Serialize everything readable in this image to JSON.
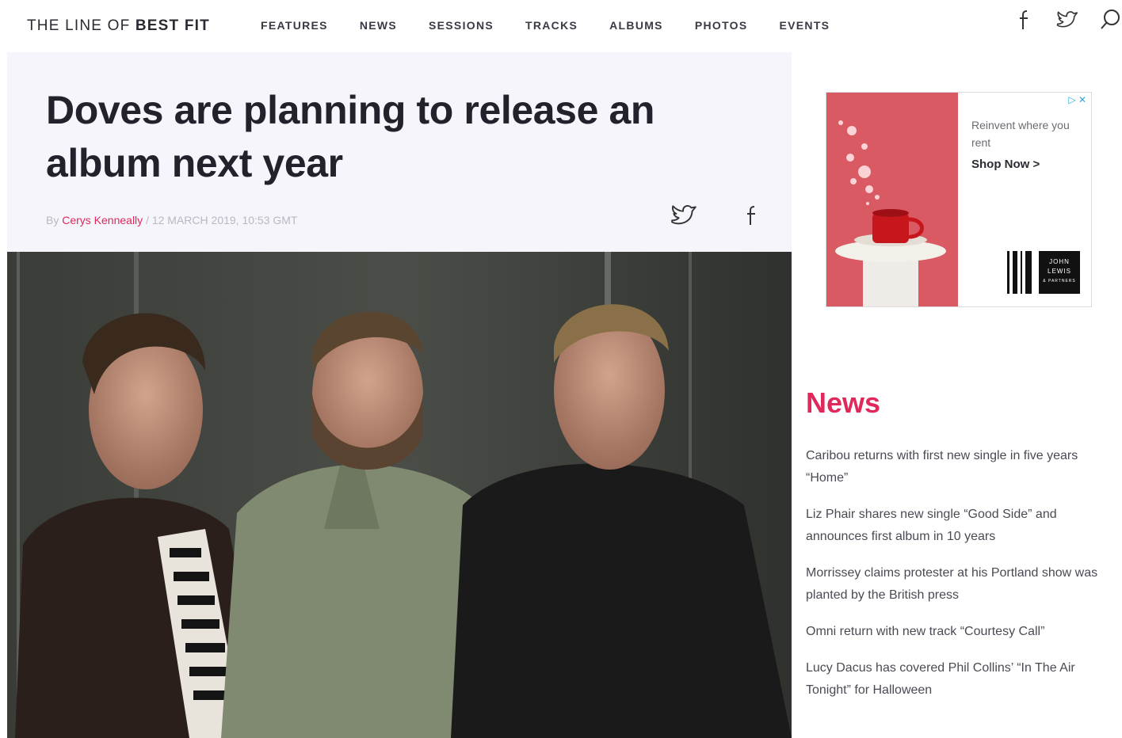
{
  "site": {
    "logo_light": "THE LINE OF",
    "logo_bold": "BEST FIT"
  },
  "nav": {
    "items": [
      "FEATURES",
      "NEWS",
      "SESSIONS",
      "TRACKS",
      "ALBUMS",
      "PHOTOS",
      "EVENTS"
    ],
    "icons": [
      "facebook-icon",
      "twitter-icon",
      "search-icon"
    ]
  },
  "article": {
    "headline": "Doves are planning to release an album next year",
    "byline_prefix": "By",
    "author": "Cerys Kenneally",
    "date_sep": "/",
    "date": "12 MARCH 2019, 10:53 GMT",
    "share_icons": [
      "twitter-icon",
      "facebook-icon"
    ]
  },
  "ad": {
    "text": "Reinvent where you rent",
    "cta": "Shop Now >",
    "badge": "▷ ✕",
    "brand_lines": [
      "JOHN",
      "LEWIS",
      "& PARTNERS"
    ],
    "colors": {
      "panel": "#d95a63",
      "accent": "#c8161d"
    }
  },
  "sidebar": {
    "news_heading": "News",
    "news_items": [
      "Caribou returns with first new single in five years “Home”",
      "Liz Phair shares new single “Good Side” and announces first album in 10 years",
      "Morrissey claims protester at his Portland show was planted by the British press",
      "Omni return with new track “Courtesy Call”",
      "Lucy Dacus has covered Phil Collins’ “In The Air Tonight” for Halloween"
    ]
  },
  "colors": {
    "accent": "#e0285b",
    "header_bg": "#f6f5fb",
    "text": "#22222c"
  }
}
